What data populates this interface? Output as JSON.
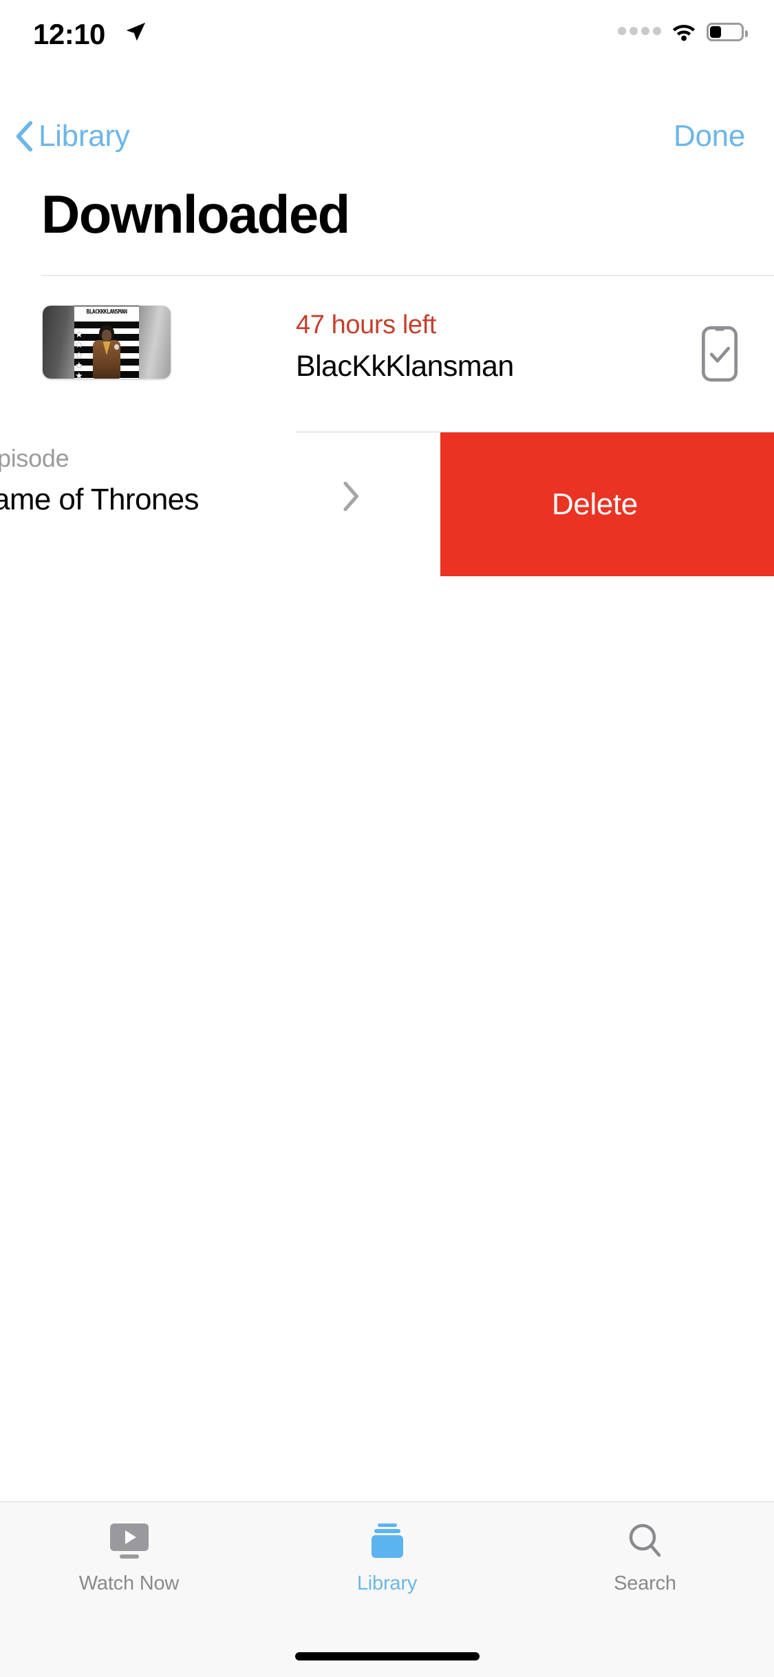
{
  "status_bar": {
    "time": "12:10",
    "location_icon": "location-arrow-icon",
    "cellular_icon": "cellular-dots-icon",
    "wifi_icon": "wifi-icon",
    "battery_icon": "battery-icon",
    "battery_level_percent": 34
  },
  "nav": {
    "back_label": "Library",
    "back_icon": "chevron-left-icon",
    "done_label": "Done",
    "accent_color": "#6cb6e8"
  },
  "header": {
    "title": "Downloaded"
  },
  "list": {
    "rows": [
      {
        "kind": "movie",
        "thumbnail_icon": "movie-poster-thumbnail",
        "poster_text": "BLACKKKLANSMAN",
        "status": "47 hours left",
        "status_color": "#c4402e",
        "title": "BlacKkKlansman",
        "trailing_icon": "iphone-downloaded-check-icon"
      },
      {
        "kind": "show",
        "subtitle": "pisode",
        "title": "ame of Thrones",
        "disclosure_icon": "chevron-right-icon",
        "swipe_action": {
          "label": "Delete",
          "color": "#ea3323"
        }
      }
    ]
  },
  "tab_bar": {
    "items": [
      {
        "label": "Watch Now",
        "icon": "tv-play-icon",
        "active": false
      },
      {
        "label": "Library",
        "icon": "library-stack-icon",
        "active": true
      },
      {
        "label": "Search",
        "icon": "magnifier-icon",
        "active": false
      }
    ]
  },
  "home_indicator": "home-indicator-bar"
}
